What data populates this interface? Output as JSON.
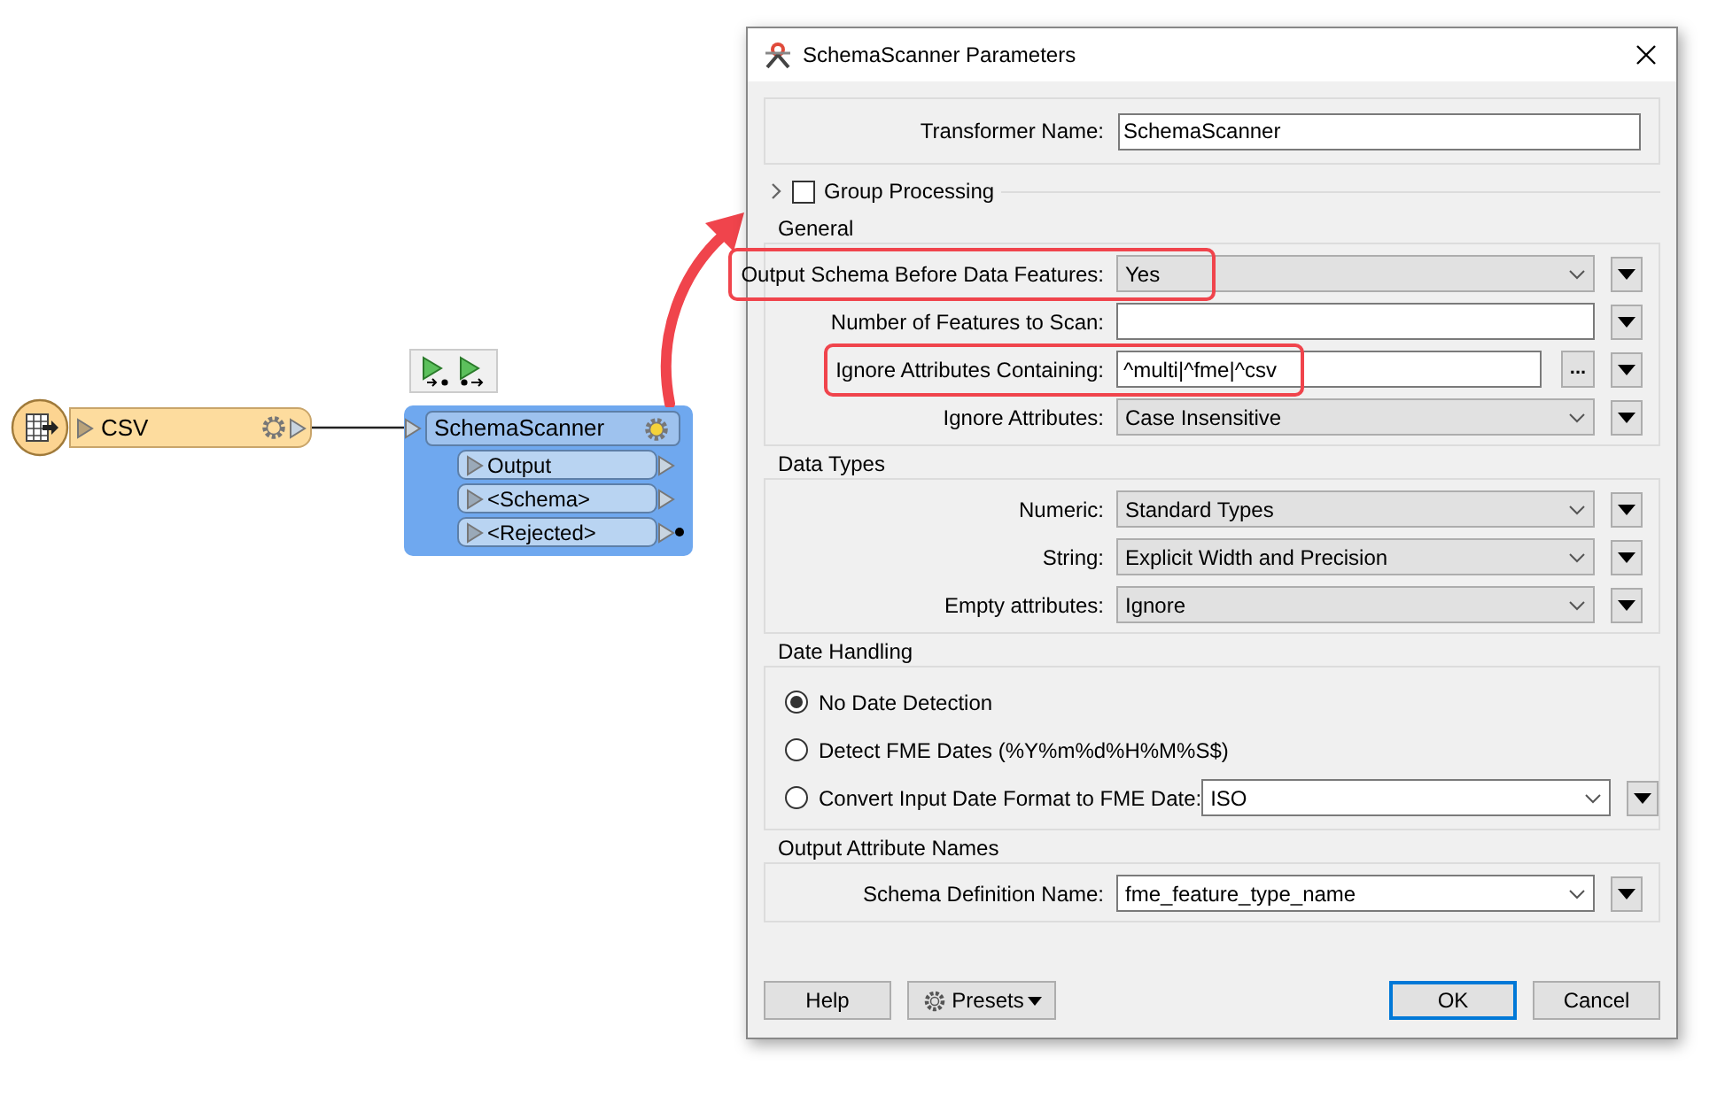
{
  "canvas": {
    "reader": {
      "label": "CSV"
    },
    "transformer": {
      "label": "SchemaScanner",
      "ports": [
        {
          "label": "Output",
          "connected": false
        },
        {
          "label": "<Schema>",
          "connected": false
        },
        {
          "label": "<Rejected>",
          "connected": true
        }
      ]
    }
  },
  "dialog": {
    "title": "SchemaScanner Parameters",
    "transformer_name": {
      "label": "Transformer Name:",
      "value": "SchemaScanner"
    },
    "group_processing": {
      "label": "Group Processing",
      "checked": false,
      "expanded": false
    },
    "groups": [
      {
        "title": "General",
        "rows": [
          {
            "kind": "select",
            "label": "Output Schema Before Data Features:",
            "value": "Yes",
            "highlighted": true
          },
          {
            "kind": "text",
            "label": "Number of Features to Scan:",
            "highlighted": false
          },
          {
            "kind": "text_button",
            "label": "Ignore Attributes Containing:",
            "value": "^multi|^fme|^csv",
            "button": "...",
            "highlighted": true
          },
          {
            "kind": "select",
            "label": "Ignore Attributes:",
            "value": "Case Insensitive",
            "highlighted": false
          }
        ]
      },
      {
        "title": "Data Types",
        "rows": [
          {
            "kind": "select",
            "label": "Numeric:",
            "value": "Standard Types",
            "highlighted": false
          },
          {
            "kind": "select",
            "label": "String:",
            "value": "Explicit Width and Precision",
            "highlighted": false
          },
          {
            "kind": "select",
            "label": "Empty attributes:",
            "value": "Ignore",
            "highlighted": false
          }
        ]
      },
      {
        "title": "Date Handling",
        "rows": [
          {
            "kind": "radio",
            "label": "No Date Detection",
            "selected": true,
            "highlighted": false
          },
          {
            "kind": "radio",
            "label": "Detect FME Dates (%Y%m%d%H%M%S$)",
            "selected": false,
            "highlighted": false
          },
          {
            "kind": "radio_combo",
            "label": "Convert Input Date Format to FME Date:",
            "value": "ISO",
            "selected": false,
            "highlighted": false
          }
        ]
      },
      {
        "title": "Output Attribute Names",
        "rows": [
          {
            "kind": "combo",
            "label": "Schema Definition Name:",
            "value": "fme_feature_type_name",
            "highlighted": false
          }
        ]
      }
    ],
    "buttons": [
      {
        "kind": "plain",
        "label": "Help",
        "default": false
      },
      {
        "kind": "menu",
        "label": "Presets",
        "default": false
      },
      {
        "kind": "spacer"
      },
      {
        "kind": "plain",
        "label": "OK",
        "default": true
      },
      {
        "kind": "plain",
        "label": "Cancel",
        "default": false
      }
    ]
  }
}
